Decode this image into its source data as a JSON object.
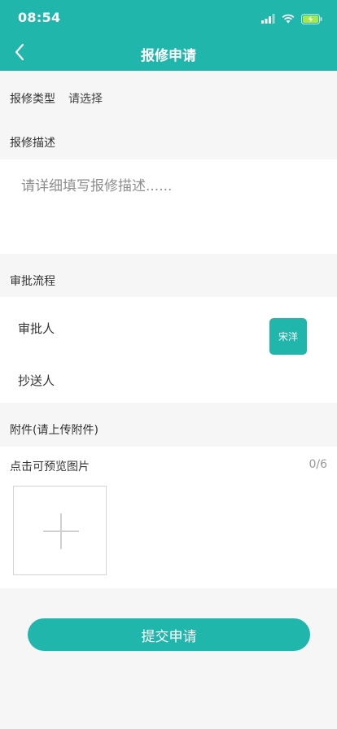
{
  "status_bar": {
    "time": "08:54",
    "icons": [
      "signal-icon",
      "wifi-icon",
      "battery-charging-icon"
    ]
  },
  "nav": {
    "title": "报修申请",
    "back_icon": "chevron-left-icon"
  },
  "form": {
    "repair_type": {
      "label": "报修类型",
      "value": "请选择"
    },
    "repair_description": {
      "section_label": "报修描述",
      "placeholder": "请详细填写报修描述......",
      "value": ""
    },
    "approval_flow": {
      "section_label": "审批流程",
      "approver_label": "审批人",
      "approver_name": "宋洋",
      "cc_label": "抄送人"
    },
    "attachments": {
      "section_label": "附件(请上传附件)",
      "hint": "点击可预览图片",
      "count": "0/6",
      "add_icon": "plus-icon"
    },
    "submit_label": "提交申请"
  },
  "colors": {
    "brand": "#21b6ac",
    "background": "#f6f6f6",
    "placeholder": "#8e8e8e"
  }
}
